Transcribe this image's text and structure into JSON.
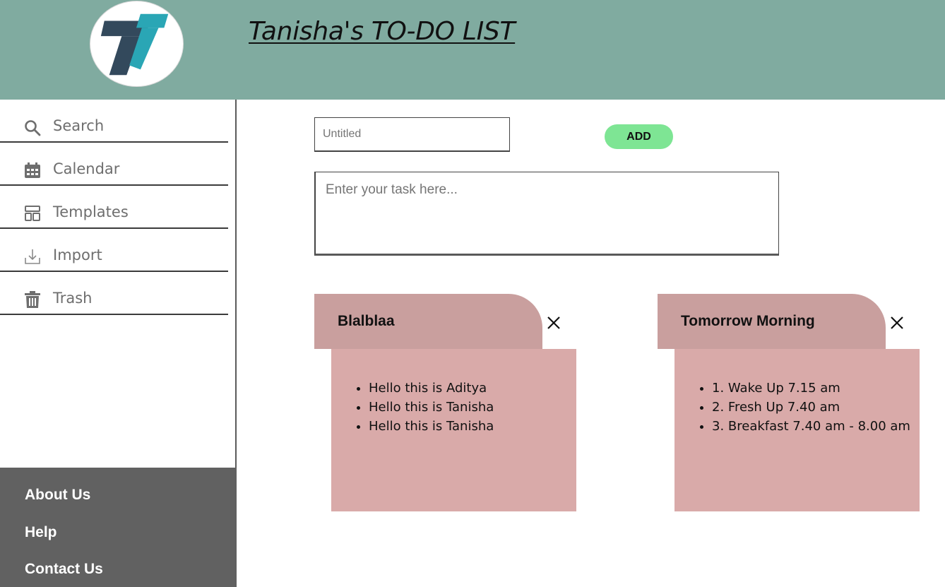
{
  "header": {
    "title": "Tanisha's TO-DO LIST",
    "logo_icon": "t-letter-logo",
    "background_color": "#80aba0"
  },
  "sidebar": {
    "items": [
      {
        "label": "Search",
        "icon": "search-icon"
      },
      {
        "label": "Calendar",
        "icon": "calendar-icon"
      },
      {
        "label": "Templates",
        "icon": "templates-icon"
      },
      {
        "label": "Import",
        "icon": "import-icon"
      },
      {
        "label": "Trash",
        "icon": "trash-icon"
      }
    ],
    "footer_links": [
      "About Us",
      "Help",
      "Contact Us"
    ],
    "footer_color": "#616161"
  },
  "editor": {
    "title_placeholder": "Untitled",
    "add_label": "ADD",
    "task_placeholder": "Enter your task here...",
    "add_color": "#7ee594"
  },
  "notes": [
    {
      "title": "Blalblaa",
      "items": [
        "Hello this is Aditya",
        "Hello this is Tanisha",
        "Hello this is Tanisha"
      ]
    },
    {
      "title": "Tomorrow Morning",
      "items": [
        "1. Wake Up 7.15 am",
        "2. Fresh Up 7.40 am",
        "3. Breakfast 7.40 am - 8.00 am"
      ]
    }
  ],
  "note_colors": {
    "tab": "#c99f9e",
    "body": "#d9aaa9"
  }
}
